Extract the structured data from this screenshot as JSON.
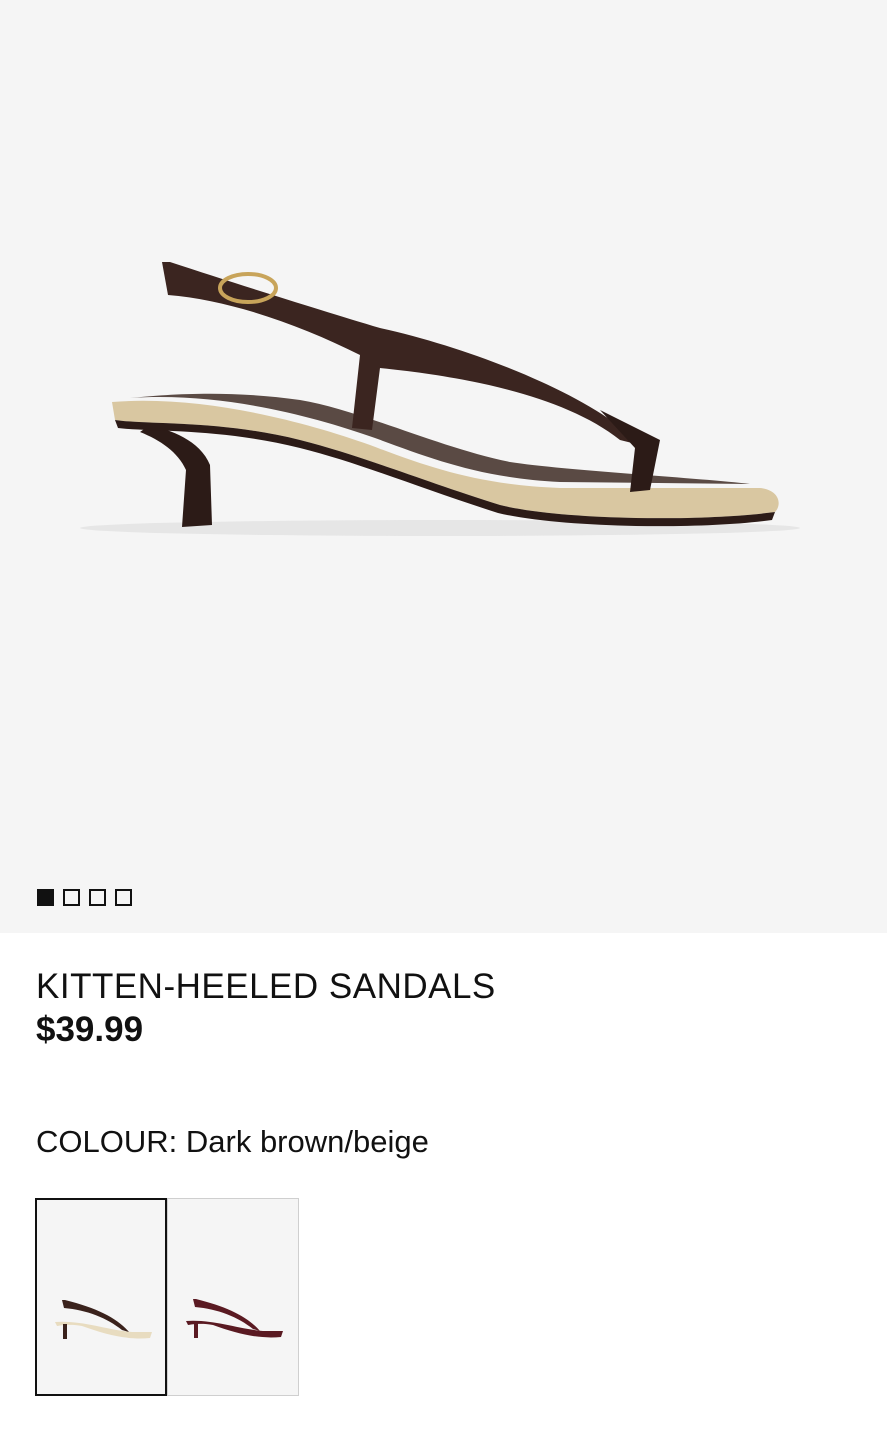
{
  "product": {
    "title": "KITTEN-HEELED SANDALS",
    "price": "$39.99",
    "colour_label": "COLOUR:",
    "colour_value": "Dark brown/beige"
  },
  "gallery": {
    "image_count": 4,
    "active_index": 0
  },
  "swatches": [
    {
      "name": "Dark brown/beige",
      "selected": true,
      "strap_color": "#3a221c",
      "sole_color": "#e8dcc0"
    },
    {
      "name": "Burgundy",
      "selected": false,
      "strap_color": "#5a1a22",
      "sole_color": "#5a1a22"
    }
  ],
  "colors": {
    "strap": "#3b2520",
    "jute": "#d9c7a1",
    "insole": "#ece4cf",
    "buckle": "#c8a45a",
    "background": "#f5f5f5"
  }
}
